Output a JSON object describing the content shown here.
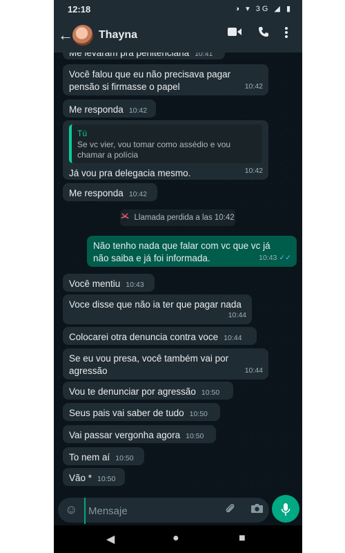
{
  "status_bar": {
    "time": "12:18",
    "icons": "◑ ▾ 3G ◢ ▮"
  },
  "header": {
    "contact_name": "Thayna",
    "icons": {
      "back": "arrow-left-icon",
      "video": "video-call-icon",
      "call": "phone-icon",
      "menu": "more-vert-icon"
    }
  },
  "messages": [
    {
      "text": "Me levaram pra penitenciária",
      "time": "10:41"
    },
    {
      "text": "Você falou que eu não precisava pagar pensão si firmasse o papel",
      "time": "10:42"
    },
    {
      "text": "Me responda",
      "time": "10:42"
    },
    {
      "quote_author": "Tú",
      "quote_text": "Se vc vier, vou tomar como assédio e vou chamar a polícia",
      "text": "Já vou pra delegacia mesmo.",
      "time": "10:42"
    },
    {
      "text": "Me responda",
      "time": "10:42"
    },
    {
      "text": "Não tenho nada que falar com vc que vc já não saiba e já foi informada.",
      "time": "10:43",
      "ticks": "✓✓"
    },
    {
      "text": "Você mentiu",
      "time": "10:43"
    },
    {
      "text": "Voce disse que não ia ter que pagar nada",
      "time": "10:44"
    },
    {
      "text": "Colocarei otra denuncia contra voce",
      "time": "10:44"
    },
    {
      "text": "Se eu vou presa, você também vai por agressão",
      "time": "10:44"
    },
    {
      "text": "Vou te denunciar por agressão",
      "time": "10:50"
    },
    {
      "text": "Seus pais vai saber de tudo",
      "time": "10:50"
    },
    {
      "text": "Vai passar vergonha agora",
      "time": "10:50"
    },
    {
      "text": "To nem aí",
      "time": "10:50"
    },
    {
      "text": "Vão *",
      "time": "10:50"
    }
  ],
  "system_message": {
    "icon": "missed-call-icon",
    "text": "Llamada perdida a las 10:42"
  },
  "input": {
    "placeholder": "Mensaje",
    "value": ""
  },
  "colors": {
    "incoming": "#202c33",
    "outgoing": "#005c4b",
    "accent": "#00a884",
    "background": "#0b141a"
  }
}
